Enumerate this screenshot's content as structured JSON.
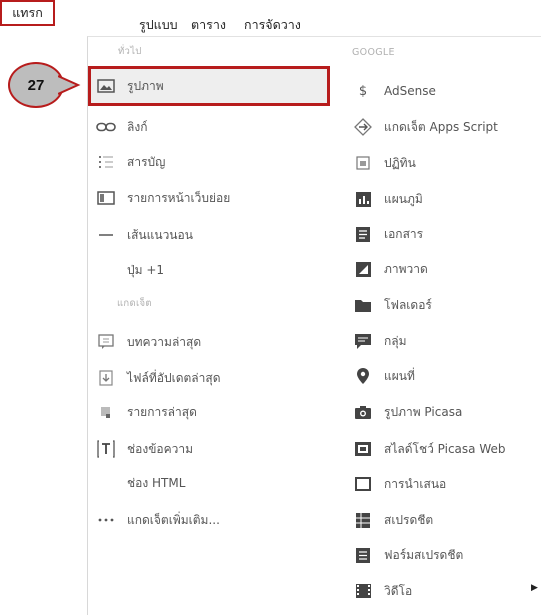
{
  "menubar": {
    "insert": "แทรก",
    "format": "รูปแบบ",
    "table": "ตาราง",
    "layout": "การจัดวาง"
  },
  "callout": {
    "number": "27"
  },
  "sections": {
    "general": "ทั่วไป",
    "gadgets": "แกดเจ็ต",
    "google": "GOOGLE"
  },
  "left_items": [
    {
      "label": "รูปภาพ",
      "icon": "image-icon"
    },
    {
      "label": "ลิงก์",
      "icon": "link-icon"
    },
    {
      "label": "สารบัญ",
      "icon": "toc-icon"
    },
    {
      "label": "รายการหน้าเว็บย่อย",
      "icon": "subpage-list-icon"
    },
    {
      "label": "เส้นแนวนอน",
      "icon": "horizontal-line-icon"
    },
    {
      "label": "ปุ่ม +1",
      "icon": ""
    }
  ],
  "gadget_items": [
    {
      "label": "บทความล่าสุด",
      "icon": "recent-posts-icon"
    },
    {
      "label": "ไฟล์ที่อัปเดตล่าสุด",
      "icon": "recent-files-icon"
    },
    {
      "label": "รายการล่าสุด",
      "icon": "recent-list-icon"
    },
    {
      "label": "ช่องข้อความ",
      "icon": "text-box-icon"
    },
    {
      "label": "ช่อง HTML",
      "icon": ""
    },
    {
      "label": "แกดเจ็ตเพิ่มเติม...",
      "icon": "more-icon"
    }
  ],
  "google_items": [
    {
      "label": "AdSense",
      "icon": "dollar-icon"
    },
    {
      "label": "แกดเจ็ต Apps Script",
      "icon": "apps-script-icon"
    },
    {
      "label": "ปฏิทิน",
      "icon": "calendar-icon"
    },
    {
      "label": "แผนภูมิ",
      "icon": "chart-icon"
    },
    {
      "label": "เอกสาร",
      "icon": "document-icon"
    },
    {
      "label": "ภาพวาด",
      "icon": "drawing-icon"
    },
    {
      "label": "โฟลเดอร์",
      "icon": "folder-icon"
    },
    {
      "label": "กลุ่ม",
      "icon": "group-icon"
    },
    {
      "label": "แผนที่",
      "icon": "map-pin-icon"
    },
    {
      "label": "รูปภาพ Picasa",
      "icon": "camera-icon"
    },
    {
      "label": "สไลด์โชว์ Picasa Web",
      "icon": "slideshow-icon"
    },
    {
      "label": "การนำเสนอ",
      "icon": "presentation-icon"
    },
    {
      "label": "สเปรดชีต",
      "icon": "spreadsheet-icon"
    },
    {
      "label": "ฟอร์มสเปรดชีต",
      "icon": "form-icon"
    },
    {
      "label": "วิดีโอ",
      "icon": "video-icon"
    }
  ],
  "colors": {
    "accent": "#b71c1c",
    "highlight_bg": "#eeeeee",
    "callout_bg": "#bdbdbd"
  }
}
